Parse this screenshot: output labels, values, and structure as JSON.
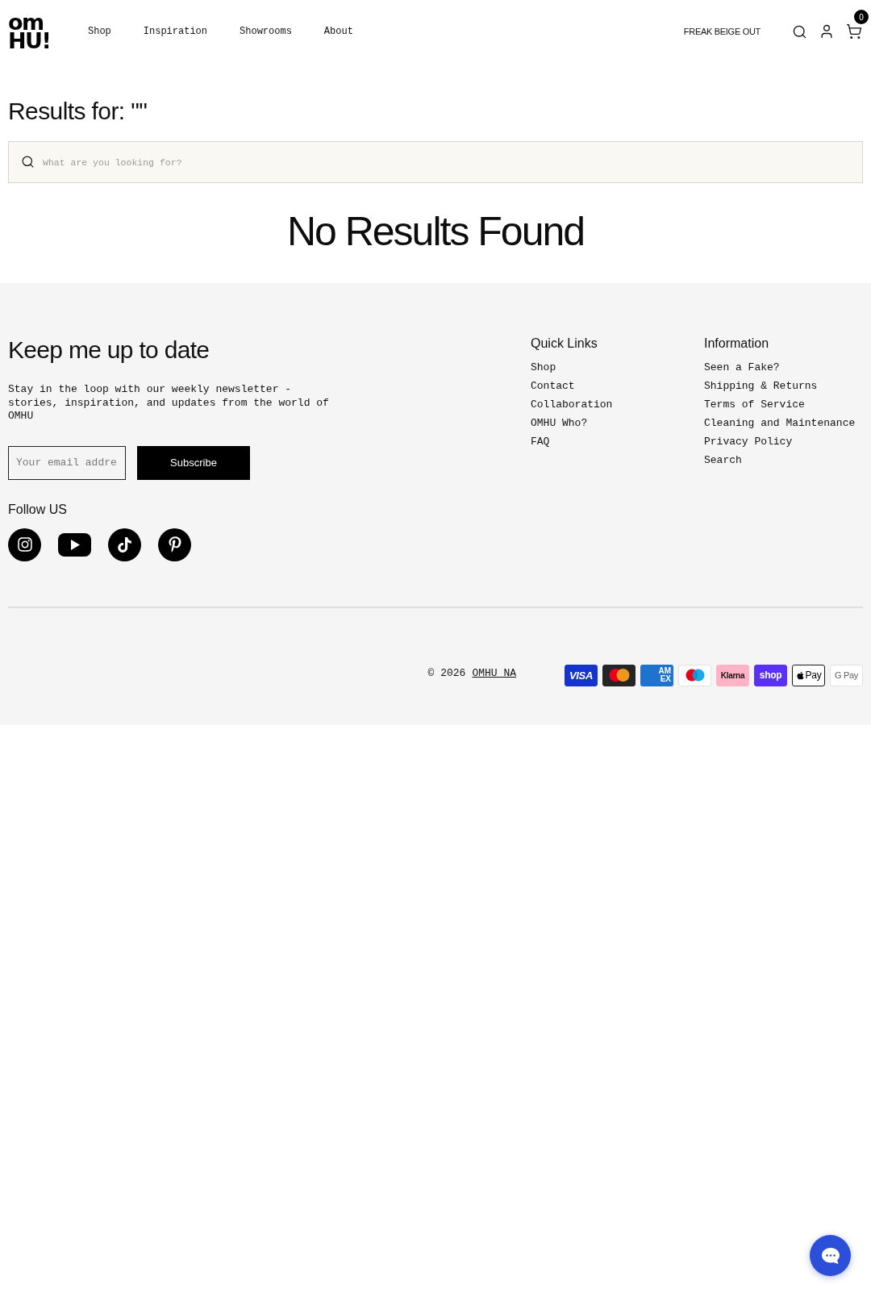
{
  "header": {
    "logo": "om HU!",
    "nav": [
      "Shop",
      "Inspiration",
      "Showrooms",
      "About"
    ],
    "promo_link": "FREAK BEIGE OUT",
    "cart_count": "0"
  },
  "results": {
    "title": "Results for: \"\"",
    "search_placeholder": "What are you looking for?",
    "empty_message": "No Results Found"
  },
  "footer": {
    "newsletter": {
      "heading": "Keep me up to date",
      "text": "Stay in the loop with our weekly newsletter - stories, inspiration, and updates from the world of OMHU",
      "email_placeholder": "Your email addre",
      "button": "Subscribe"
    },
    "follow": {
      "heading": "Follow US",
      "networks": [
        {
          "kind": "instagram"
        },
        {
          "kind": "youtube"
        },
        {
          "kind": "tiktok"
        },
        {
          "kind": "pinterest"
        }
      ]
    },
    "link_columns": [
      {
        "heading": "Quick Links",
        "links": [
          "Shop",
          "Contact",
          "Collaboration",
          "OMHU Who?",
          "FAQ"
        ]
      },
      {
        "heading": "Information",
        "links": [
          "Seen a Fake?",
          "Shipping & Returns",
          "Terms of Service",
          "Cleaning and Maintenance",
          "Privacy Policy",
          "Search"
        ]
      }
    ],
    "copyright": {
      "text": "© 2026",
      "link": "OMHU NA"
    },
    "payment_methods": [
      {
        "kind": "visa",
        "label": "VISA"
      },
      {
        "kind": "mastercard"
      },
      {
        "kind": "amex",
        "label": "AM EX"
      },
      {
        "kind": "maestro"
      },
      {
        "kind": "klarna",
        "label": "Klarna"
      },
      {
        "kind": "shop",
        "label": "shop"
      },
      {
        "kind": "applepay",
        "label": "Pay"
      },
      {
        "kind": "googlepay",
        "label": "G Pay"
      }
    ]
  }
}
